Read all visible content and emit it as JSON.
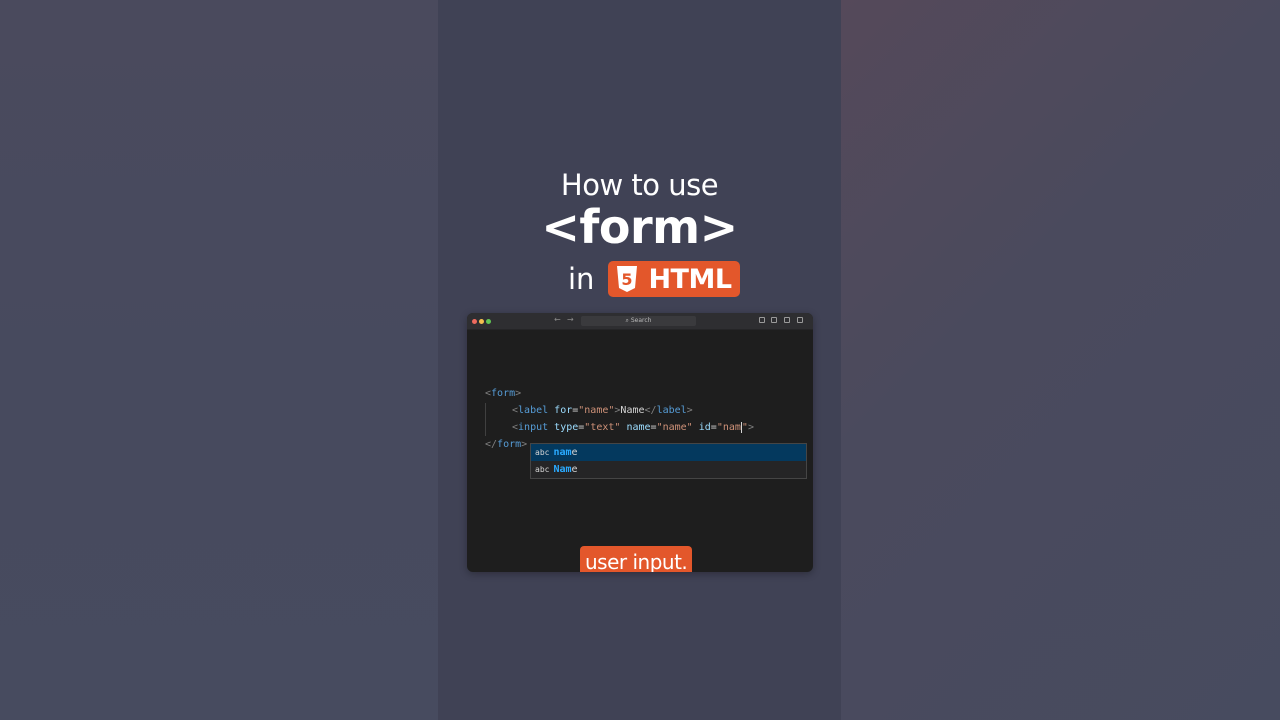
{
  "title": {
    "line1": "How to use",
    "line2": "<form>",
    "line3_prefix": "in",
    "badge_number": "5",
    "badge_text": "HTML"
  },
  "window": {
    "search_placeholder": "Search",
    "back_arrow": "←",
    "forward_arrow": "→",
    "icons": [
      "back-arrow-icon",
      "forward-arrow-icon",
      "search-icon",
      "split-editor-icon",
      "toggle-sidebar-icon",
      "toggle-panel-icon",
      "toggle-secondary-sidebar-icon"
    ]
  },
  "code": {
    "line1": {
      "open": "<",
      "tag": "form",
      "close": ">"
    },
    "line2": {
      "open": "<",
      "tag": "label",
      "attr1": "for",
      "eq1": "=",
      "val1": "\"name\"",
      "close": ">",
      "text": "Name",
      "end_open": "</",
      "end_tag": "label",
      "end_close": ">"
    },
    "line3": {
      "open": "<",
      "tag": "input",
      "attr1": "type",
      "eq1": "=",
      "val1": "\"text\"",
      "attr2": "name",
      "eq2": "=",
      "val2": "\"name\"",
      "attr3": "id",
      "eq3": "=",
      "val3": "\"nam",
      "val3_end": "\"",
      "close": ">"
    },
    "line4": {
      "open": "</",
      "tag": "form",
      "close": ">"
    }
  },
  "autocomplete": {
    "items": [
      {
        "kind": "abc",
        "match": "nam",
        "rest": "e",
        "selected": true
      },
      {
        "kind": "abc",
        "match": "Nam",
        "rest": "e",
        "selected": false
      }
    ]
  },
  "caption": "user input.",
  "colors": {
    "accent": "#e3572b",
    "background": "#404255",
    "editor_bg": "#1e1e1e",
    "tag": "#569cd6",
    "attribute": "#9cdcfe",
    "string": "#ce9178",
    "suggestion_highlight": "#2aaaff"
  }
}
